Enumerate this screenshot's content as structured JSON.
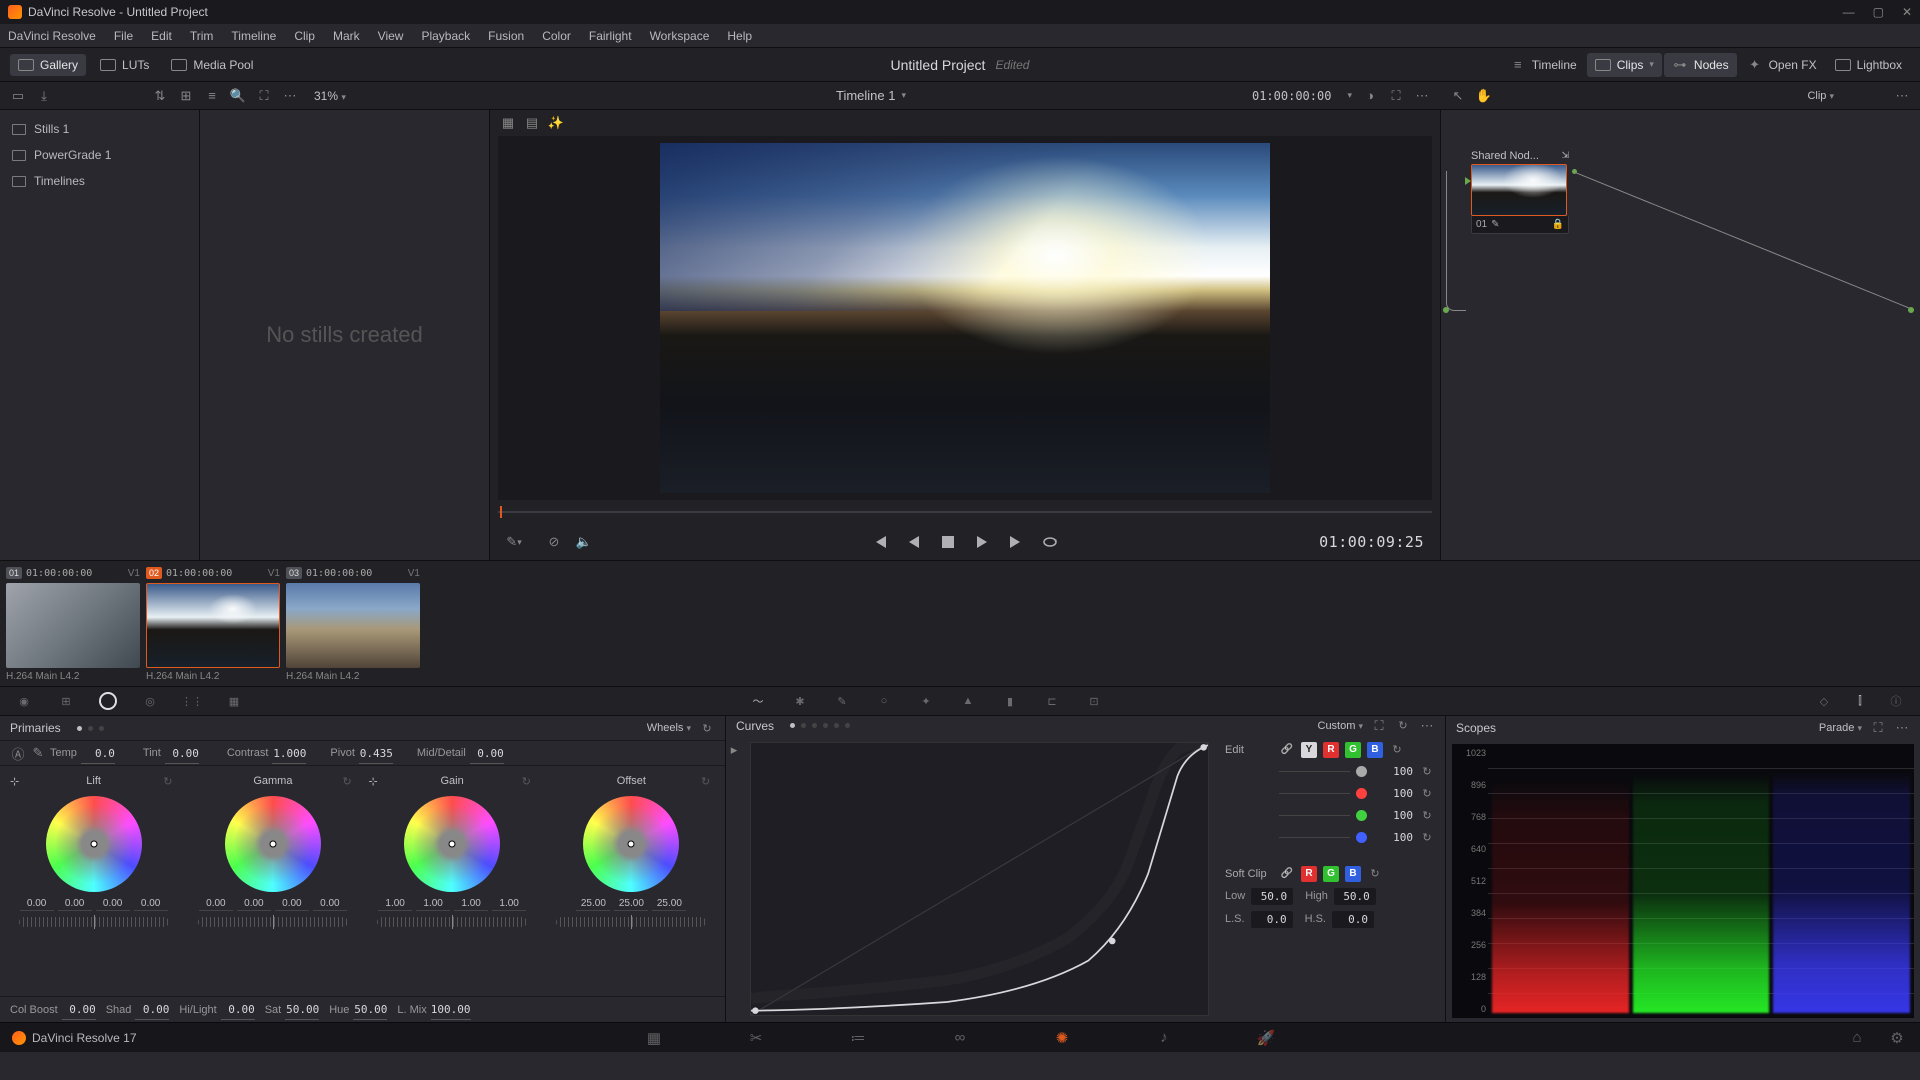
{
  "window": {
    "title": "DaVinci Resolve - Untitled Project"
  },
  "menu": [
    "DaVinci Resolve",
    "File",
    "Edit",
    "Trim",
    "Timeline",
    "Clip",
    "Mark",
    "View",
    "Playback",
    "Fusion",
    "Color",
    "Fairlight",
    "Workspace",
    "Help"
  ],
  "toolbar": {
    "gallery": "Gallery",
    "luts": "LUTs",
    "media_pool": "Media Pool",
    "project": "Untitled Project",
    "edited": "Edited",
    "timeline": "Timeline",
    "clips": "Clips",
    "nodes": "Nodes",
    "openfx": "Open FX",
    "lightbox": "Lightbox"
  },
  "optrow": {
    "zoom": "31%",
    "timeline_name": "Timeline 1",
    "tc": "01:00:00:00",
    "clip_mode": "Clip"
  },
  "gallery_items": [
    {
      "label": "Stills 1"
    },
    {
      "label": "PowerGrade 1"
    },
    {
      "label": "Timelines"
    }
  ],
  "stills_empty": "No stills created",
  "nodes": {
    "shared_label": "Shared Nod...",
    "node_num": "01"
  },
  "transport": {
    "tc_big": "01:00:09:25"
  },
  "clips": [
    {
      "num": "01",
      "tc": "01:00:00:00",
      "track": "V1",
      "name": "H.264 Main L4.2",
      "sel": false
    },
    {
      "num": "02",
      "tc": "01:00:00:00",
      "track": "V1",
      "name": "H.264 Main L4.2",
      "sel": true
    },
    {
      "num": "03",
      "tc": "01:00:00:00",
      "track": "V1",
      "name": "H.264 Main L4.2",
      "sel": false
    }
  ],
  "primaries": {
    "title": "Primaries",
    "mode": "Wheels",
    "adj": {
      "temp": "0.0",
      "tint": "0.00",
      "contrast": "1.000",
      "pivot": "0.435",
      "mid": "0.00"
    },
    "wheels": [
      {
        "name": "Lift",
        "v": [
          "0.00",
          "0.00",
          "0.00",
          "0.00"
        ]
      },
      {
        "name": "Gamma",
        "v": [
          "0.00",
          "0.00",
          "0.00",
          "0.00"
        ]
      },
      {
        "name": "Gain",
        "v": [
          "1.00",
          "1.00",
          "1.00",
          "1.00"
        ]
      },
      {
        "name": "Offset",
        "v": [
          "25.00",
          "25.00",
          "25.00"
        ]
      }
    ],
    "adj2": {
      "colboost": "0.00",
      "shad": "0.00",
      "hilight": "0.00",
      "sat": "50.00",
      "hue": "50.00",
      "lmix": "100.00"
    }
  },
  "curves": {
    "title": "Curves",
    "mode": "Custom",
    "edit_label": "Edit",
    "channels": [
      {
        "c": "#aaa",
        "v": "100"
      },
      {
        "c": "#ff4040",
        "v": "100"
      },
      {
        "c": "#40d040",
        "v": "100"
      },
      {
        "c": "#4060ff",
        "v": "100"
      }
    ],
    "softclip_label": "Soft Clip",
    "sc": {
      "low_l": "Low",
      "low": "50.0",
      "high_l": "High",
      "high": "50.0",
      "ls_l": "L.S.",
      "ls": "0.0",
      "hs_l": "H.S.",
      "hs": "0.0"
    }
  },
  "scopes": {
    "title": "Scopes",
    "mode": "Parade",
    "scale": [
      "1023",
      "896",
      "768",
      "640",
      "512",
      "384",
      "256",
      "128",
      "0"
    ]
  },
  "footer": {
    "app": "DaVinci Resolve 17"
  },
  "labels": {
    "temp": "Temp",
    "tint": "Tint",
    "contrast": "Contrast",
    "pivot": "Pivot",
    "mid": "Mid/Detail",
    "colboost": "Col Boost",
    "shad": "Shad",
    "hilight": "Hi/Light",
    "sat": "Sat",
    "hue": "Hue",
    "lmix": "L. Mix"
  }
}
